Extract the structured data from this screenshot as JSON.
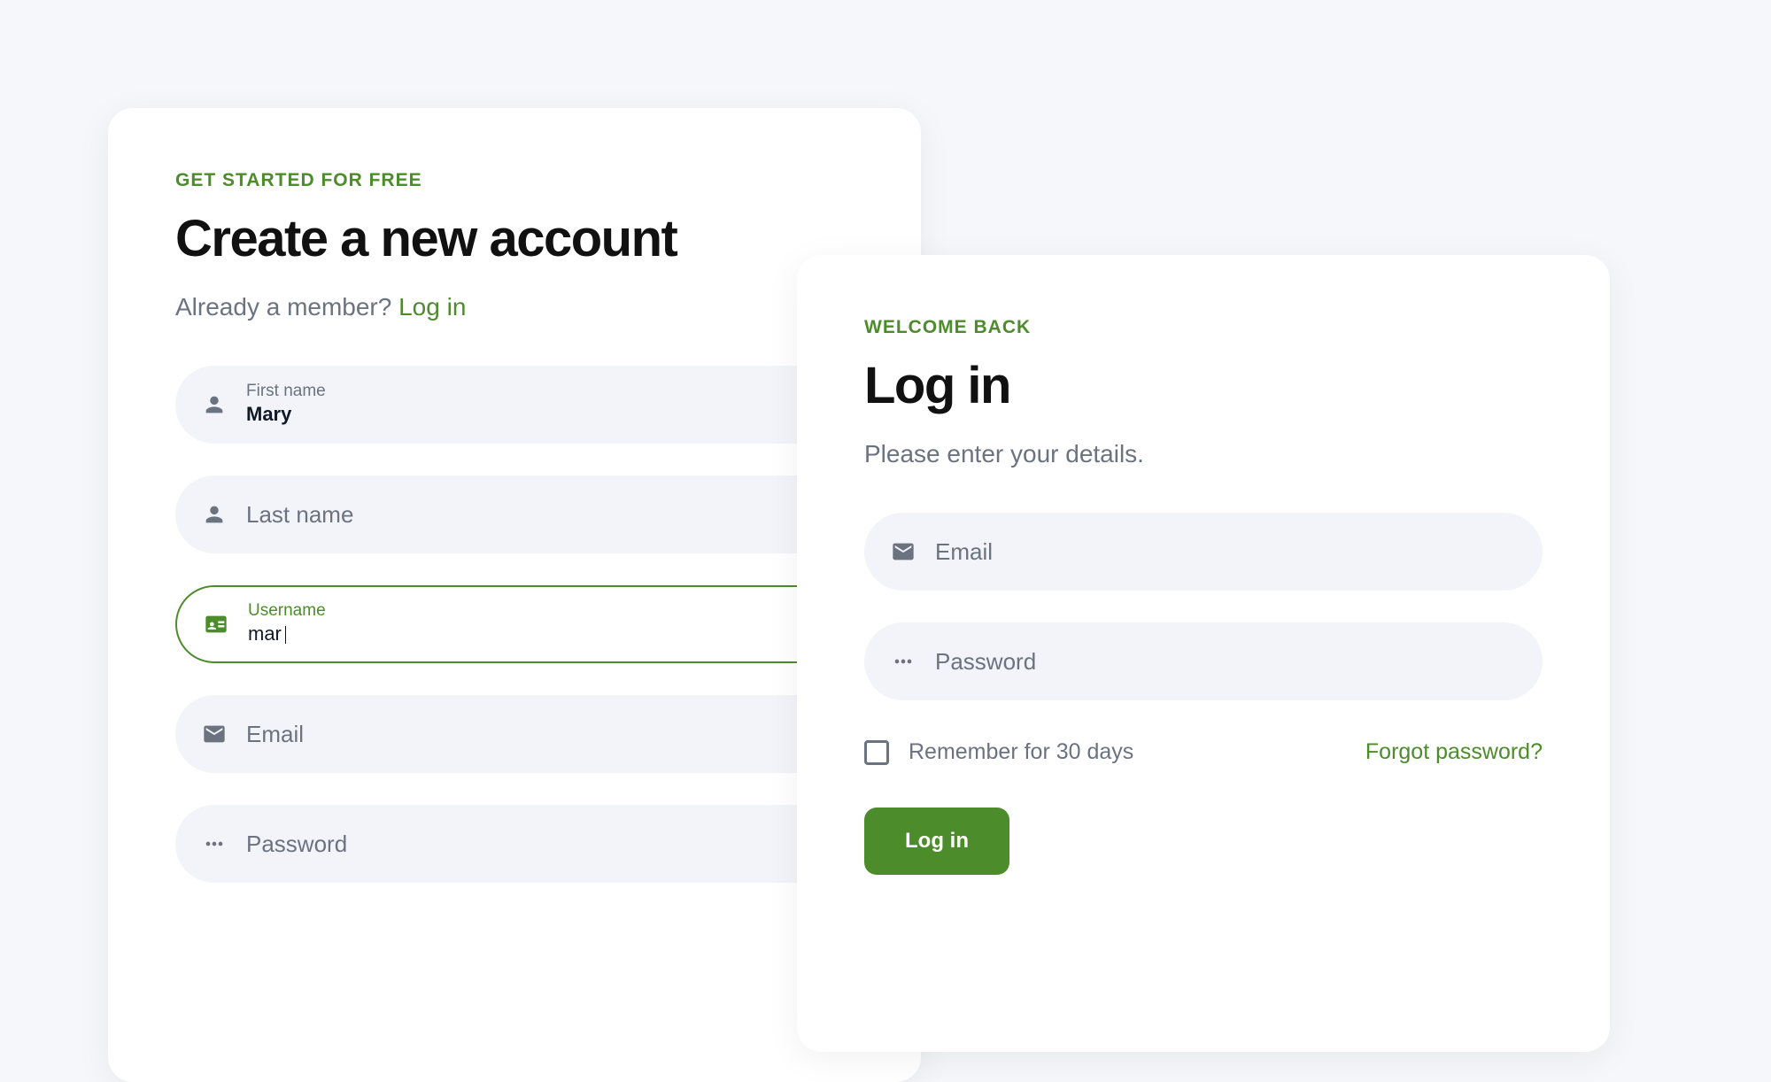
{
  "signup": {
    "eyebrow": "GET STARTED FOR FREE",
    "title": "Create a new account",
    "subtext": "Already a member? ",
    "login_link": "Log in",
    "fields": {
      "first_name": {
        "label": "First name",
        "value": "Mary"
      },
      "last_name": {
        "placeholder": "Last name"
      },
      "username": {
        "label": "Username",
        "value": "mar"
      },
      "email": {
        "placeholder": "Email"
      },
      "password": {
        "placeholder": "Password"
      }
    }
  },
  "login": {
    "eyebrow": "WELCOME BACK",
    "title": "Log in",
    "subtext": "Please enter your details.",
    "fields": {
      "email": {
        "placeholder": "Email"
      },
      "password": {
        "placeholder": "Password"
      }
    },
    "remember_label": "Remember for 30 days",
    "forgot_link": "Forgot password?",
    "submit_label": "Log in"
  }
}
